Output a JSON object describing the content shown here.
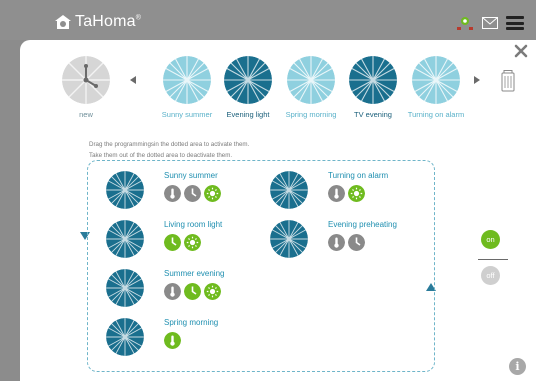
{
  "app": {
    "brand": "TaHoma",
    "brand_mark": "®"
  },
  "colors": {
    "dark_teal": "#1a6f8e",
    "light_teal": "#8fd0df",
    "green": "#6fbb1f",
    "grey": "#8a8a8a"
  },
  "scenarios": [
    {
      "label": "new",
      "style": "grey"
    },
    {
      "label": "Sunny summer",
      "style": "light"
    },
    {
      "label": "Evening light",
      "style": "dark"
    },
    {
      "label": "Spring morning",
      "style": "light"
    },
    {
      "label": "TV evening",
      "style": "dark"
    },
    {
      "label": "Turning on alarm",
      "style": "light"
    }
  ],
  "instructions": {
    "line1": "Drag the programmingsin the dotted area to activate them.",
    "line2": "Take them out of the dotted area to deactivate them."
  },
  "programs": [
    {
      "name": "Sunny summer",
      "icons": [
        "thermometer-icon",
        "clock-icon",
        "sun-icon"
      ],
      "colors": [
        "grey",
        "grey",
        "green"
      ]
    },
    {
      "name": "Turning on alarm",
      "icons": [
        "thermometer-icon",
        "sun-icon"
      ],
      "colors": [
        "grey",
        "green"
      ]
    },
    {
      "name": "Living room light",
      "icons": [
        "clock-icon",
        "sun-icon"
      ],
      "colors": [
        "green",
        "green"
      ]
    },
    {
      "name": "Evening preheating",
      "icons": [
        "thermometer-icon",
        "clock-icon"
      ],
      "colors": [
        "grey",
        "grey"
      ]
    },
    {
      "name": "Summer evening",
      "icons": [
        "thermometer-icon",
        "clock-icon",
        "sun-icon"
      ],
      "colors": [
        "grey",
        "green",
        "green"
      ]
    },
    {
      "name": "Spring morning",
      "icons": [
        "thermometer-icon"
      ],
      "colors": [
        "green"
      ]
    }
  ],
  "switch": {
    "on_label": "on",
    "off_label": "off",
    "state": "on"
  },
  "info_label": "i"
}
